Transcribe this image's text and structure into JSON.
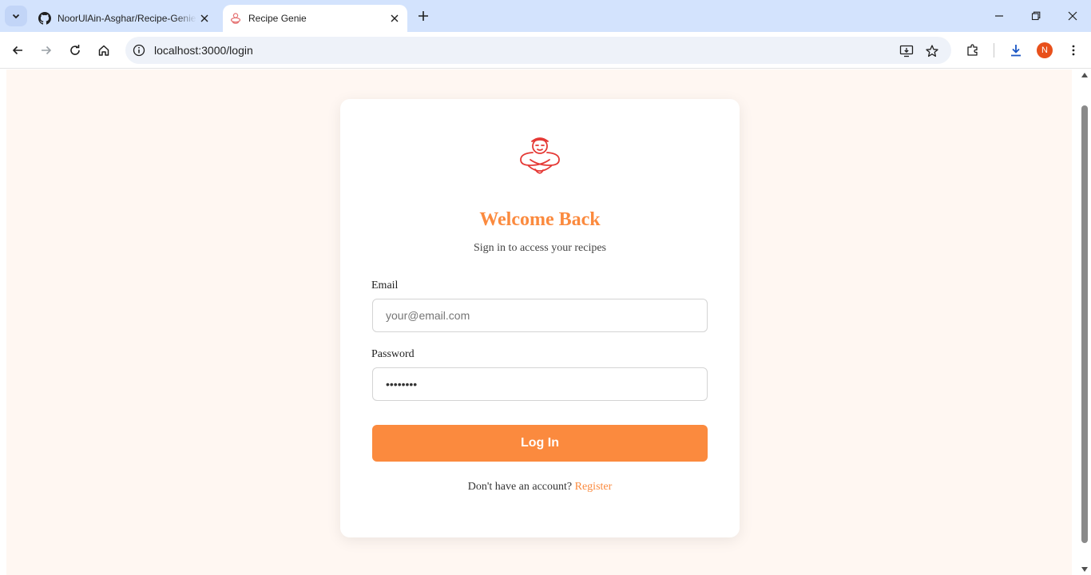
{
  "browser": {
    "tabs": [
      {
        "title": "NoorUlAin-Asghar/Recipe-Genie",
        "favicon": "github-icon",
        "active": false
      },
      {
        "title": "Recipe Genie",
        "favicon": "genie-icon",
        "active": true
      }
    ],
    "url": "localhost:3000/login",
    "profile_initial": "N",
    "profile_color": "#e8501b"
  },
  "login": {
    "heading": "Welcome Back",
    "subheading": "Sign in to access your recipes",
    "email_label": "Email",
    "email_placeholder": "your@email.com",
    "email_value": "",
    "password_label": "Password",
    "password_value": "••••••••",
    "submit_label": "Log In",
    "footer_text": "Don't have an account?",
    "footer_link": "Register"
  },
  "colors": {
    "accent": "#fb8a3e",
    "page_background": "#fff7f2",
    "logo": "#e53935"
  }
}
